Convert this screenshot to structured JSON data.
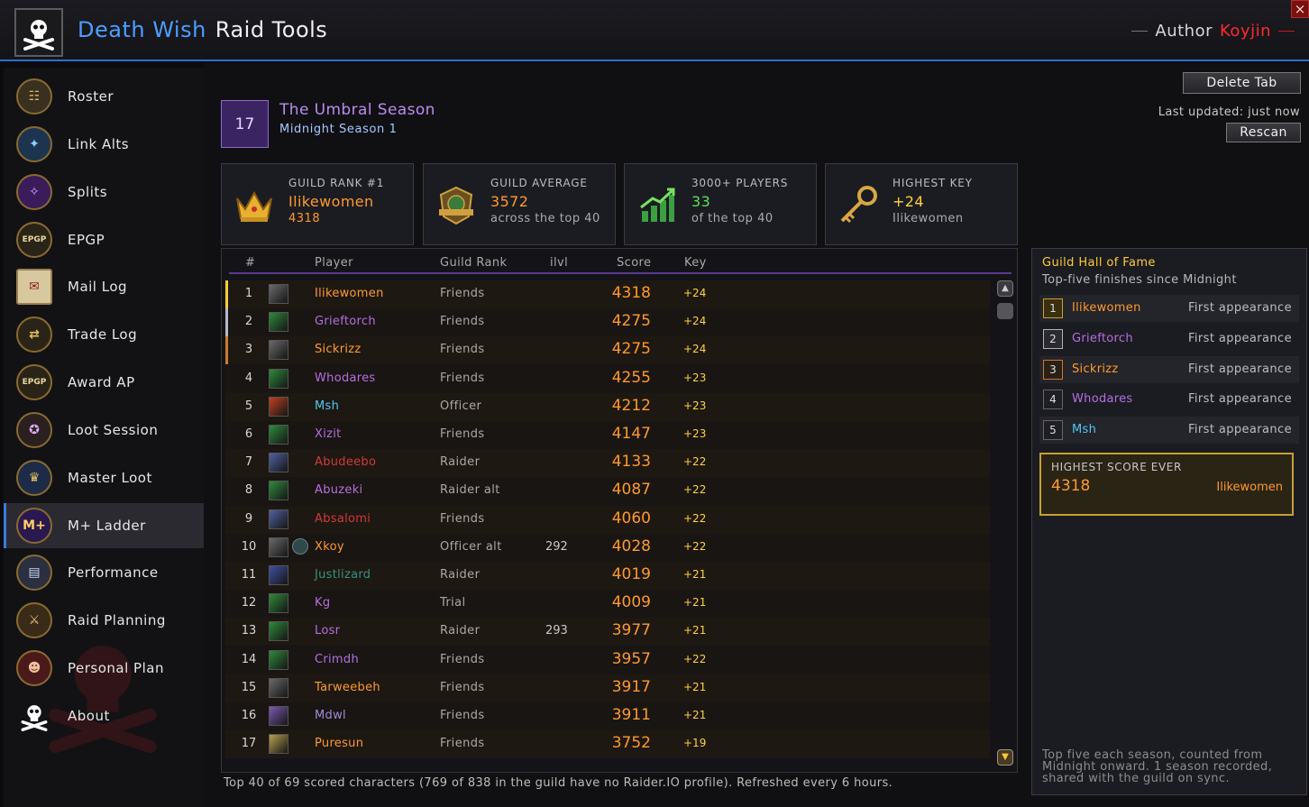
{
  "header": {
    "title_part1": "Death Wish",
    "title_part2": "Raid Tools",
    "author_label": "Author",
    "author_name": "Koyjin",
    "close": "×"
  },
  "sidebar": {
    "items": [
      {
        "label": "Roster",
        "icon": "roster-icon"
      },
      {
        "label": "Link Alts",
        "icon": "link-alts-icon"
      },
      {
        "label": "Splits",
        "icon": "splits-icon"
      },
      {
        "label": "EPGP",
        "icon": "epgp-icon"
      },
      {
        "label": "Mail Log",
        "icon": "mail-icon"
      },
      {
        "label": "Trade Log",
        "icon": "trade-icon"
      },
      {
        "label": "Award AP",
        "icon": "award-icon"
      },
      {
        "label": "Loot Session",
        "icon": "loot-session-icon"
      },
      {
        "label": "Master Loot",
        "icon": "master-loot-icon"
      },
      {
        "label": "M+ Ladder",
        "icon": "mplus-icon",
        "active": true
      },
      {
        "label": "Performance",
        "icon": "performance-icon"
      },
      {
        "label": "Raid Planning",
        "icon": "raid-planning-icon"
      },
      {
        "label": "Personal Plan",
        "icon": "personal-plan-icon"
      },
      {
        "label": "About",
        "icon": "skull-icon"
      }
    ]
  },
  "season": {
    "number": "17",
    "title": "The Umbral Season",
    "subtitle": "Midnight Season 1"
  },
  "actions": {
    "delete_tab": "Delete Tab",
    "last_updated": "Last updated: just now",
    "rescan": "Rescan"
  },
  "stats": [
    {
      "caption": "GUILD RANK #1",
      "value": "Ilikewomen",
      "sub": "4318",
      "icon": "crown-icon"
    },
    {
      "caption": "GUILD AVERAGE",
      "value": "3572",
      "sub": "across the top 40",
      "icon": "guild-average-icon"
    },
    {
      "caption": "3000+ PLAYERS",
      "value": "33",
      "sub": "of the top 40",
      "icon": "chart-up-icon"
    },
    {
      "caption": "HIGHEST KEY",
      "value": "+24",
      "sub": "Ilikewomen",
      "icon": "key-icon"
    }
  ],
  "table": {
    "headers": {
      "num": "#",
      "player": "Player",
      "rank": "Guild Rank",
      "ilvl": "ilvl",
      "score": "Score",
      "key": "Key"
    },
    "rows": [
      {
        "n": "1",
        "player": "Ilikewomen",
        "color": "#ff9a2a",
        "rank": "Friends",
        "ilvl": "",
        "score": "4318",
        "key": "+24",
        "bar": "#ffcc33",
        "cls": "#6a6a6a"
      },
      {
        "n": "2",
        "player": "Grieftorch",
        "color": "#b36fe0",
        "rank": "Friends",
        "ilvl": "",
        "score": "4275",
        "key": "+24",
        "bar": "#b8b8c8",
        "cls": "#2e8a3a"
      },
      {
        "n": "3",
        "player": "Sickrizz",
        "color": "#ff9a2a",
        "rank": "Friends",
        "ilvl": "",
        "score": "4275",
        "key": "+24",
        "bar": "#c87a30",
        "cls": "#6a6a6a"
      },
      {
        "n": "4",
        "player": "Whodares",
        "color": "#b36fe0",
        "rank": "Friends",
        "ilvl": "",
        "score": "4255",
        "key": "+23",
        "bar": "",
        "cls": "#2e8a3a"
      },
      {
        "n": "5",
        "player": "Msh",
        "color": "#4fc8f0",
        "rank": "Officer",
        "ilvl": "",
        "score": "4212",
        "key": "+23",
        "bar": "",
        "cls": "#c04020"
      },
      {
        "n": "6",
        "player": "Xizit",
        "color": "#b36fe0",
        "rank": "Friends",
        "ilvl": "",
        "score": "4147",
        "key": "+23",
        "bar": "",
        "cls": "#2e8a3a"
      },
      {
        "n": "7",
        "player": "Abudeebo",
        "color": "#d03a3a",
        "rank": "Raider",
        "ilvl": "",
        "score": "4133",
        "key": "+22",
        "bar": "",
        "cls": "#5060a0"
      },
      {
        "n": "8",
        "player": "Abuzeki",
        "color": "#b36fe0",
        "rank": "Raider alt",
        "ilvl": "",
        "score": "4087",
        "key": "+22",
        "bar": "",
        "cls": "#2e8a3a"
      },
      {
        "n": "9",
        "player": "Absalomi",
        "color": "#d03a3a",
        "rank": "Friends",
        "ilvl": "",
        "score": "4060",
        "key": "+22",
        "bar": "",
        "cls": "#5060a0"
      },
      {
        "n": "10",
        "player": "Xkoy",
        "color": "#ff9a2a",
        "rank": "Officer alt",
        "ilvl": "292",
        "score": "4028",
        "key": "+22",
        "bar": "",
        "cls": "#6a6a6a",
        "covenant": true
      },
      {
        "n": "11",
        "player": "Justlizard",
        "color": "#33937f",
        "rank": "Raider",
        "ilvl": "",
        "score": "4019",
        "key": "+21",
        "bar": "",
        "cls": "#4050a0"
      },
      {
        "n": "12",
        "player": "Kg",
        "color": "#b36fe0",
        "rank": "Trial",
        "ilvl": "",
        "score": "4009",
        "key": "+21",
        "bar": "",
        "cls": "#2e8a3a"
      },
      {
        "n": "13",
        "player": "Losr",
        "color": "#b36fe0",
        "rank": "Raider",
        "ilvl": "293",
        "score": "3977",
        "key": "+21",
        "bar": "",
        "cls": "#2e8a3a"
      },
      {
        "n": "14",
        "player": "Crimdh",
        "color": "#b36fe0",
        "rank": "Friends",
        "ilvl": "",
        "score": "3957",
        "key": "+22",
        "bar": "",
        "cls": "#2e8a3a"
      },
      {
        "n": "15",
        "player": "Tarweebeh",
        "color": "#ff9a2a",
        "rank": "Friends",
        "ilvl": "",
        "score": "3917",
        "key": "+21",
        "bar": "",
        "cls": "#6a6a6a"
      },
      {
        "n": "16",
        "player": "Mdwl",
        "color": "#a48ad8",
        "rank": "Friends",
        "ilvl": "",
        "score": "3911",
        "key": "+21",
        "bar": "",
        "cls": "#7a5ab0"
      },
      {
        "n": "17",
        "player": "Puresun",
        "color": "#ff9a2a",
        "rank": "Friends",
        "ilvl": "",
        "score": "3752",
        "key": "+19",
        "bar": "",
        "cls": "#b8a050"
      }
    ],
    "footnote": "Top 40 of 69 scored characters (769 of 838 in the guild have no Raider.IO profile). Refreshed every 6 hours."
  },
  "hall_of_fame": {
    "title": "Guild Hall of Fame",
    "subtitle": "Top-five finishes since Midnight",
    "entries": [
      {
        "n": "1",
        "name": "Ilikewomen",
        "color": "#ff9a2a",
        "status": "First appearance",
        "badge": "#c8a030",
        "badge_bg": "#3a3010"
      },
      {
        "n": "2",
        "name": "Grieftorch",
        "color": "#b36fe0",
        "status": "First appearance",
        "badge": "#b0b0b8",
        "badge_bg": "#2a2a30"
      },
      {
        "n": "3",
        "name": "Sickrizz",
        "color": "#ff9a2a",
        "status": "First appearance",
        "badge": "#c87a30",
        "badge_bg": "#2a2015"
      },
      {
        "n": "4",
        "name": "Whodares",
        "color": "#b36fe0",
        "status": "First appearance",
        "badge": "#666",
        "badge_bg": "#1e1e24"
      },
      {
        "n": "5",
        "name": "Msh",
        "color": "#4fc8f0",
        "status": "First appearance",
        "badge": "#666",
        "badge_bg": "#1e1e24"
      }
    ],
    "best_caption": "HIGHEST SCORE EVER",
    "best_value": "4318",
    "best_name": "Ilikewomen",
    "note": "Top five each season, counted from Midnight onward. 1 season recorded, shared with the guild on sync."
  }
}
